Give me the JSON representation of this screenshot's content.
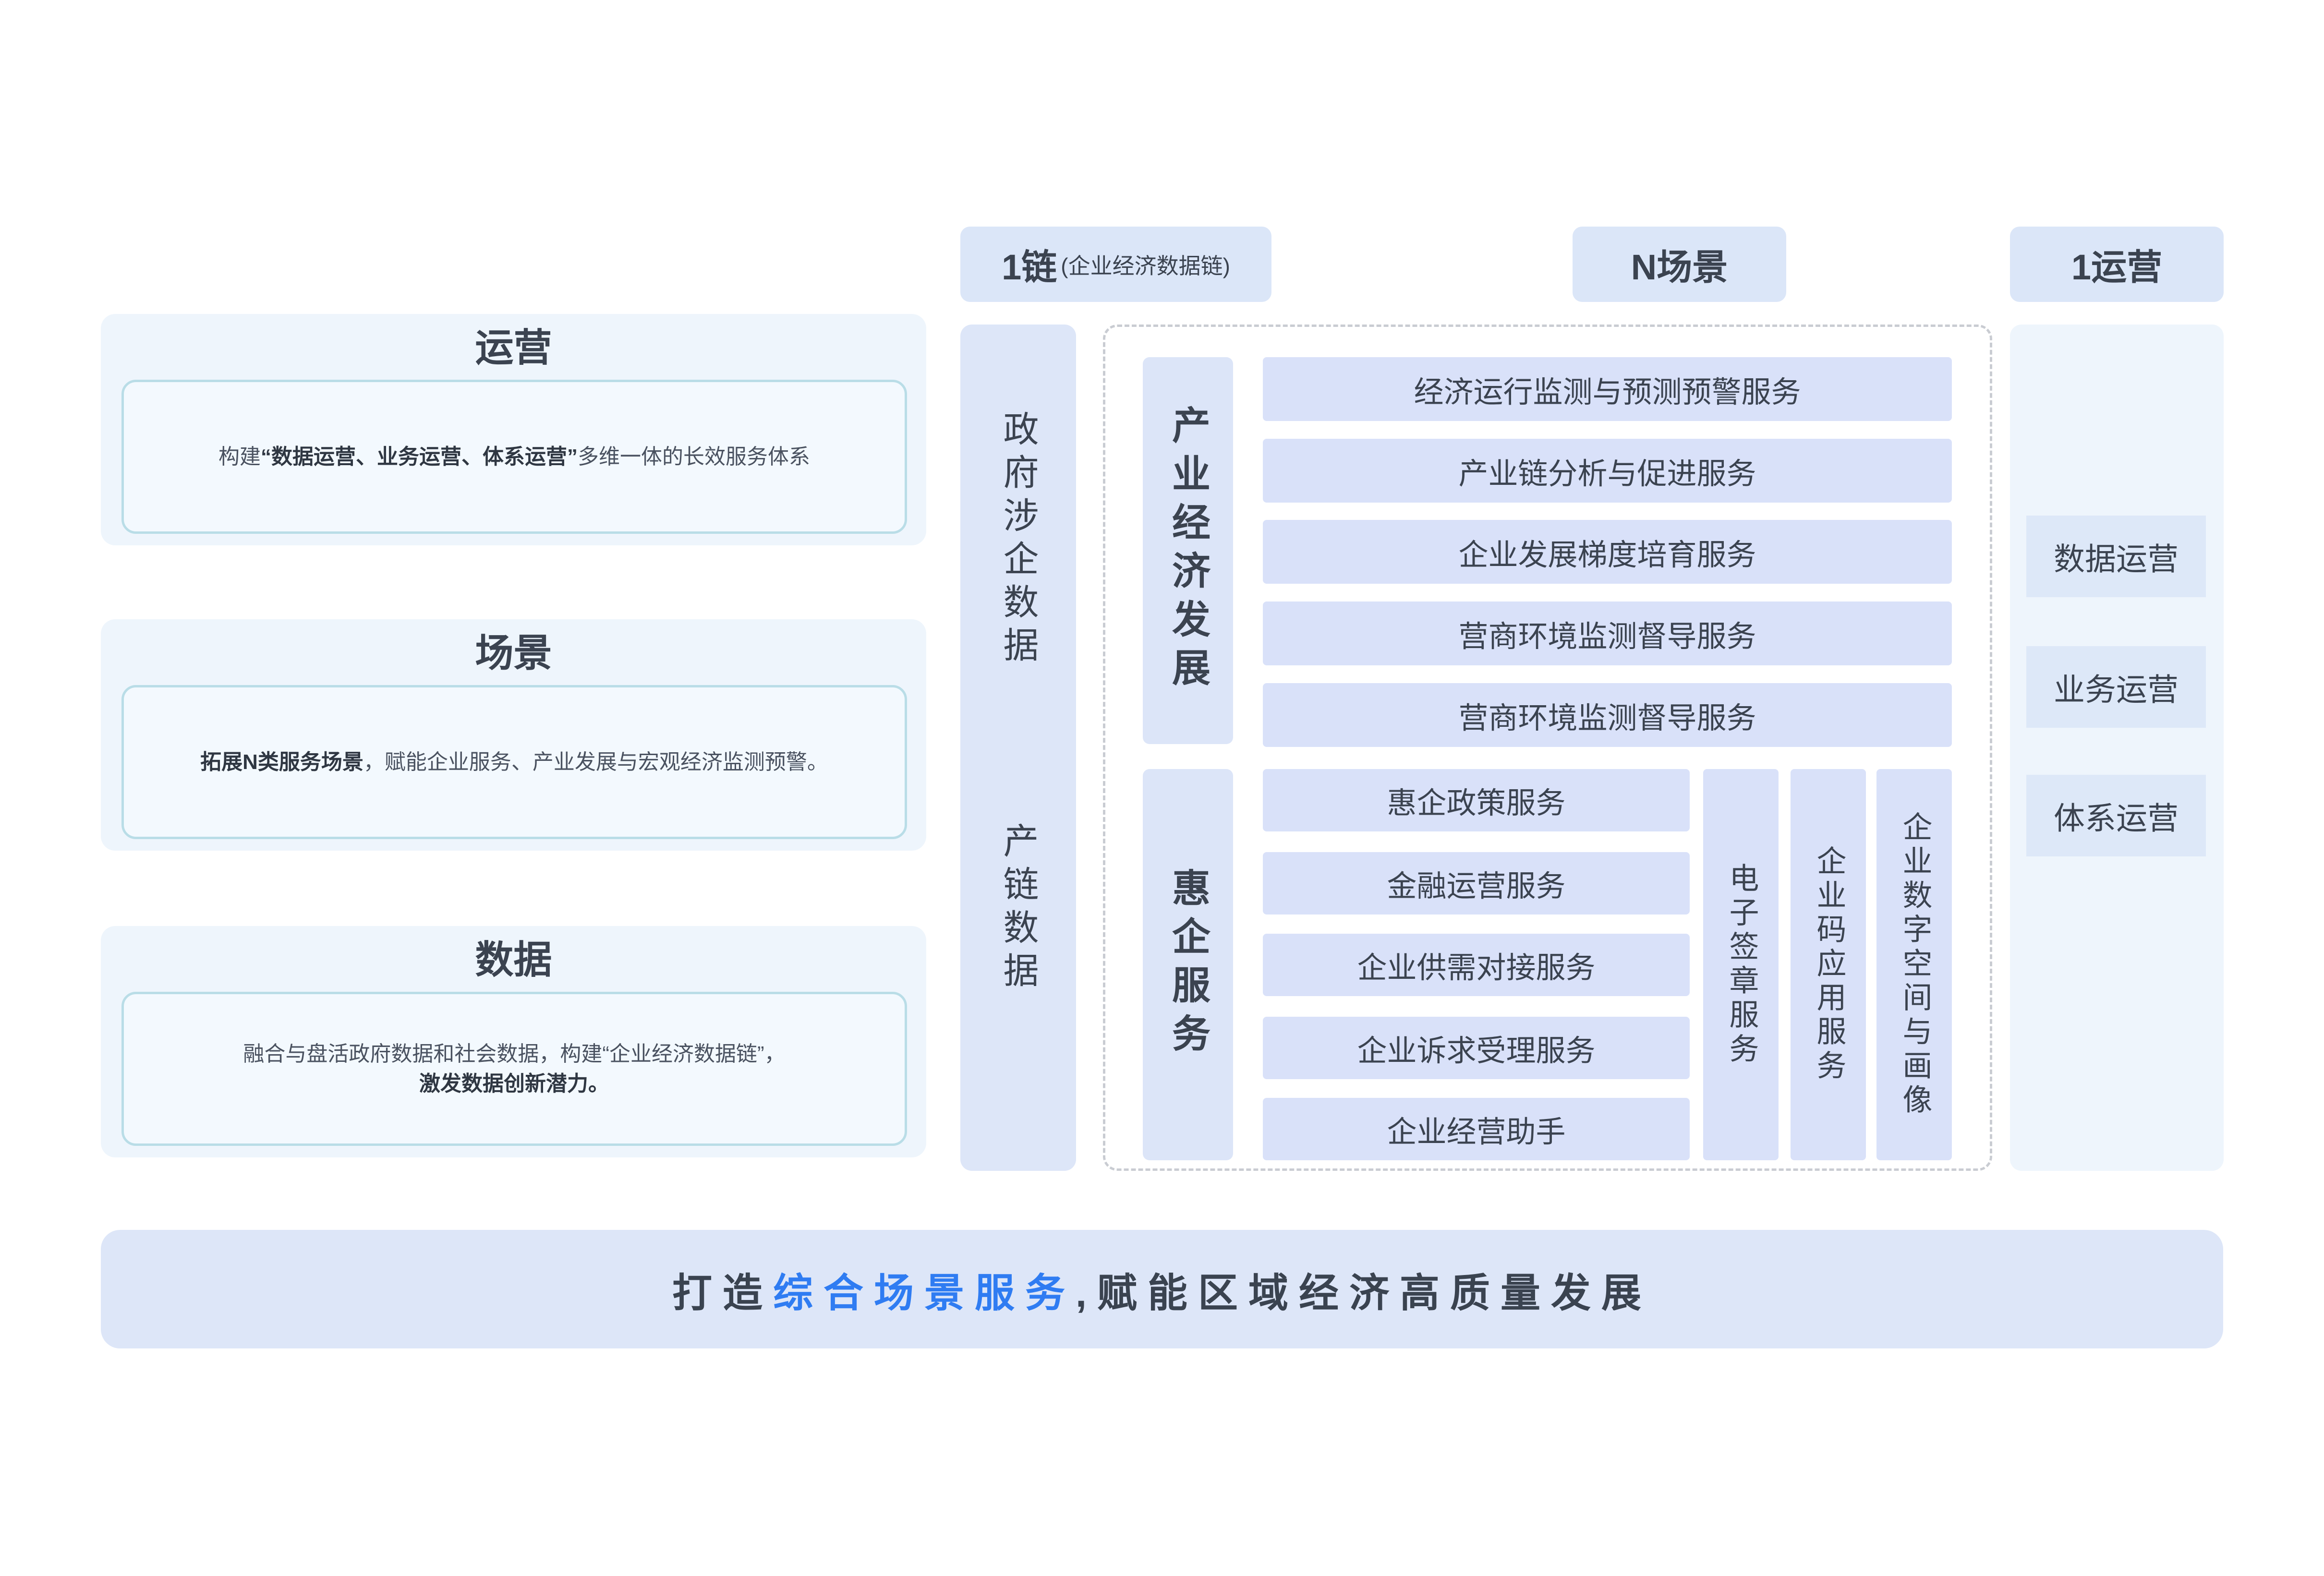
{
  "pillars": {
    "operation": {
      "title": "运营",
      "text_prefix": "构建",
      "text_bold": "“数据运营、业务运营、体系运营”",
      "text_suffix": "多维一体的长效服务体系"
    },
    "scene": {
      "title": "场景",
      "text_bold": "拓展N类服务场景",
      "text_suffix": "，赋能企业服务、产业发展与宏观经济监测预警。"
    },
    "data": {
      "title": "数据",
      "line1": "融合与盘活政府数据和社会数据，构建“企业经济数据链”，",
      "line2_bold": "激发数据创新潜力。"
    }
  },
  "header": {
    "chain": {
      "main": "1链",
      "sub": "(企业经济数据链)"
    },
    "scenes": "N场景",
    "operation": "1运营"
  },
  "data_column": {
    "groups": [
      "政府涉企数据",
      "产链数据"
    ]
  },
  "scenarios": {
    "industry": {
      "label": "产业经济发展",
      "items": [
        "经济运行监测与预测预警服务",
        "产业链分析与促进服务",
        "企业发展梯度培育服务",
        "营商环境监测督导服务",
        "营商环境监测督导服务"
      ]
    },
    "enterprise": {
      "label": "惠企服务",
      "items": [
        "惠企政策服务",
        "金融运营服务",
        "企业供需对接服务",
        "企业诉求受理服务",
        "企业经营助手"
      ],
      "vertical_items": [
        "电子签章服务",
        "企业码应用服务",
        "企业数字空间与画像"
      ]
    }
  },
  "operations": {
    "items": [
      "数据运营",
      "业务运营",
      "体系运营"
    ]
  },
  "banner": {
    "prefix": "打造",
    "highlight": "综合场景服务",
    "suffix": ",赋能区域经济高质量发展"
  },
  "colors": {
    "text": "#3b4350",
    "accent": "#2f7cf2",
    "block_bg": "#d9e1f9",
    "panel_bg": "#eef5fc"
  }
}
